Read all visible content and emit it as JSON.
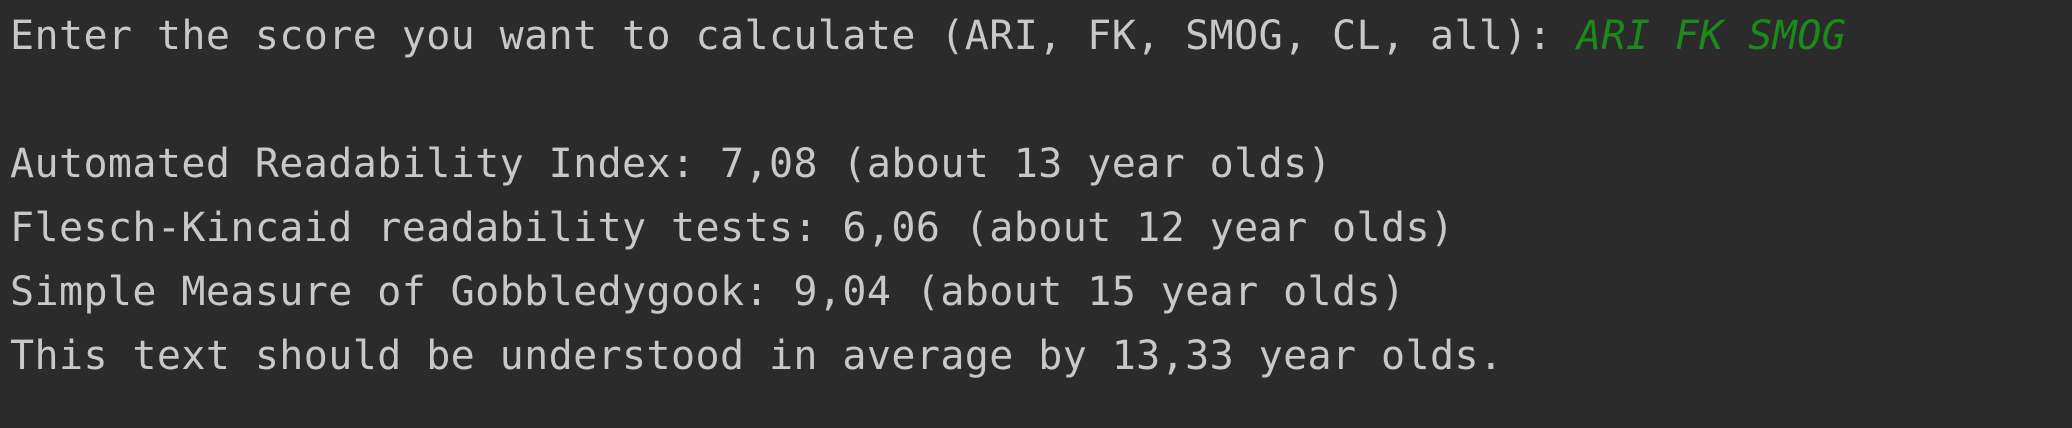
{
  "console": {
    "prompt": "Enter the score you want to calculate (ARI, FK, SMOG, CL, all): ",
    "user_input": "ARI FK SMOG",
    "output_lines": [
      "Automated Readability Index: 7,08 (about 13 year olds)",
      "Flesch-Kincaid readability tests: 6,06 (about 12 year olds)",
      "Simple Measure of Gobbledygook: 9,04 (about 15 year olds)",
      "This text should be understood in average by 13,33 year olds."
    ]
  },
  "colors": {
    "background": "#2b2b2b",
    "text": "#c8c8c8",
    "user_input": "#1b8a1b"
  }
}
